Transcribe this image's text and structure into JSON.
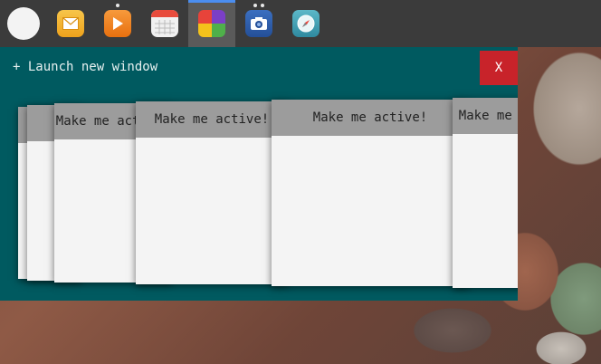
{
  "shelf": {
    "apps": [
      {
        "icon": "launcher-icon"
      },
      {
        "icon": "mail-icon",
        "color": "#f2b233"
      },
      {
        "icon": "play-icon",
        "color": "#f07c1c"
      },
      {
        "icon": "calendar-icon",
        "color": "#e8e8e8"
      },
      {
        "icon": "windows-app-icon"
      },
      {
        "icon": "camera-icon",
        "color": "#2f5ea8"
      },
      {
        "icon": "compass-icon",
        "color": "#3a9ab0"
      }
    ]
  },
  "window": {
    "launch_label": "+ Launch new window",
    "close_label": "X",
    "cards": [
      {
        "title": ""
      },
      {
        "title": ""
      },
      {
        "title": "Make me active!"
      },
      {
        "title": "Make me active!"
      },
      {
        "title": "Make me active!"
      },
      {
        "title": "Make me active!"
      }
    ]
  },
  "colors": {
    "window_bg": "#005a60",
    "close_bg": "#c8232a",
    "card_header": "#9c9c9c",
    "shelf_bg": "#3b3b3b",
    "active_indicator": "#4b8ef0"
  }
}
